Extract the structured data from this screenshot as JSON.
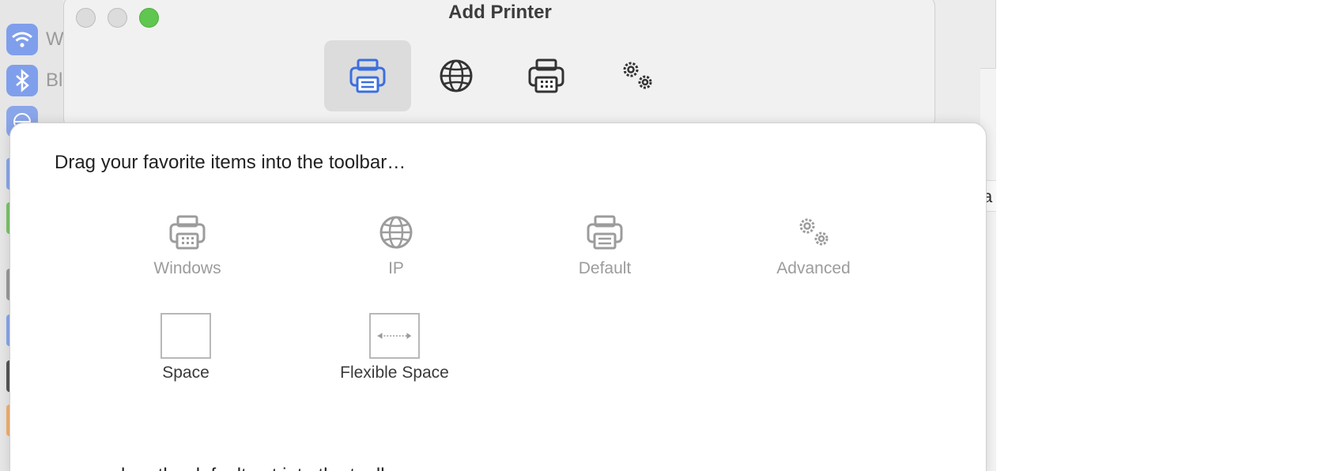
{
  "background_window": {
    "sidebar_items": [
      {
        "label": "W",
        "icon": "wifi-icon",
        "color": "#6f93e8"
      },
      {
        "label": "Bl",
        "icon": "bluetooth-icon",
        "color": "#6f93e8"
      },
      {
        "label": "",
        "icon": "network-icon",
        "color": "#7a9ae6"
      }
    ],
    "row_letter": "a"
  },
  "printer_window": {
    "title": "Add Printer",
    "toolbar": [
      {
        "icon": "printer-icon",
        "selected": true
      },
      {
        "icon": "globe-icon",
        "selected": false
      },
      {
        "icon": "windows-printer-icon",
        "selected": false
      },
      {
        "icon": "gears-icon",
        "selected": false
      }
    ]
  },
  "customize_sheet": {
    "instructions": "Drag your favorite items into the toolbar…",
    "palette": [
      {
        "label": "Windows",
        "icon": "windows-printer-icon"
      },
      {
        "label": "IP",
        "icon": "globe-icon"
      },
      {
        "label": "Default",
        "icon": "printer-icon"
      },
      {
        "label": "Advanced",
        "icon": "gears-icon"
      }
    ],
    "spaces": [
      {
        "label": "Space"
      },
      {
        "label": "Flexible Space"
      }
    ],
    "default_set_text": "…or drag the default set into the toolbar."
  },
  "colors": {
    "accent": "#3b6fe0",
    "close": "#dcdcdc",
    "zoom": "#5fc64f"
  }
}
